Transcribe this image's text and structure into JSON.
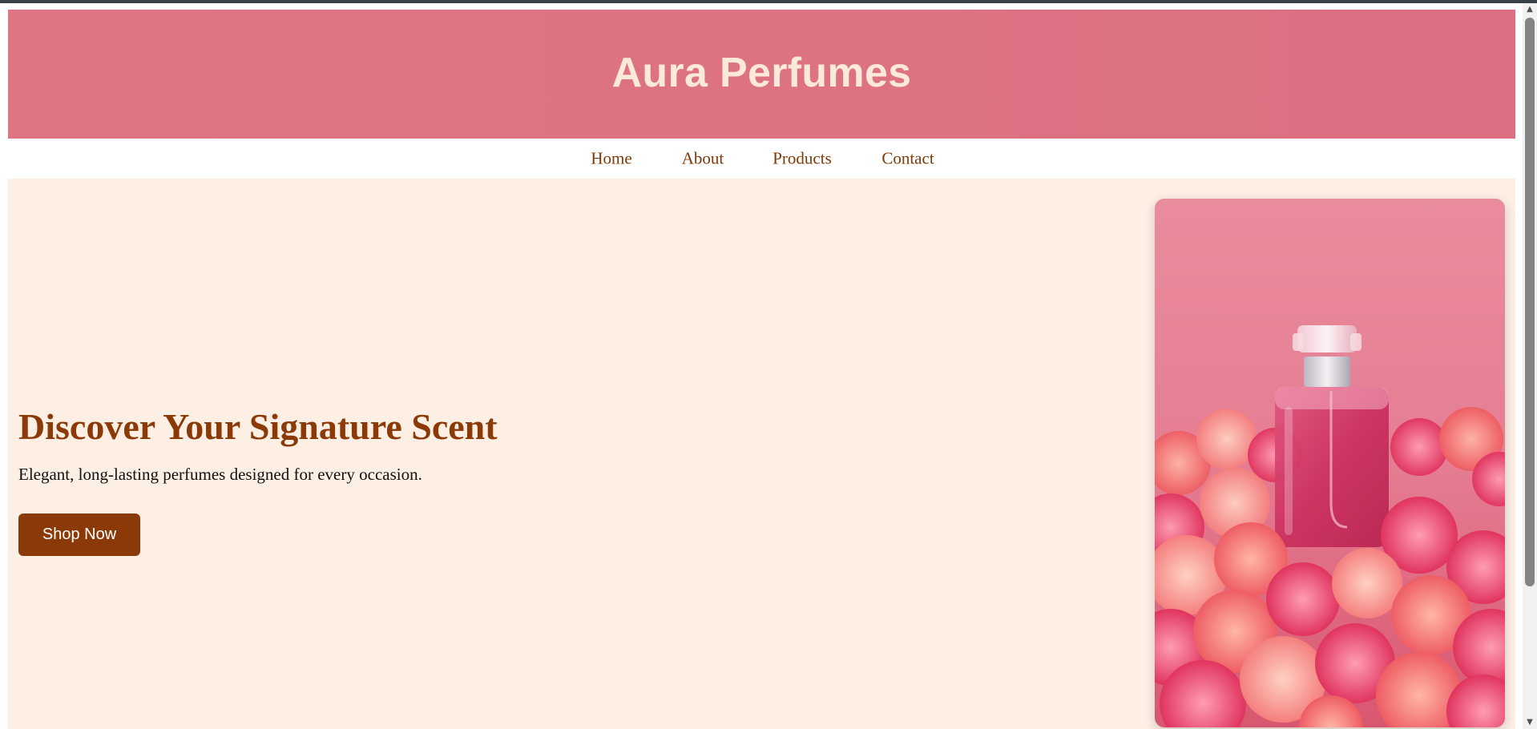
{
  "header": {
    "title": "Aura Perfumes"
  },
  "nav": {
    "items": [
      {
        "label": "Home"
      },
      {
        "label": "About"
      },
      {
        "label": "Products"
      },
      {
        "label": "Contact"
      }
    ]
  },
  "hero": {
    "heading": "Discover Your Signature Scent",
    "subtitle": "Elegant, long-lasting perfumes designed for every occasion.",
    "cta_label": "Shop Now",
    "image_name": "perfume-bottle-with-pink-flowers"
  },
  "colors": {
    "header_bg": "#dc7383",
    "header_text": "#fde8dc",
    "nav_text": "#7e3a05",
    "hero_bg": "#fdefe4",
    "accent": "#8b3a07"
  }
}
